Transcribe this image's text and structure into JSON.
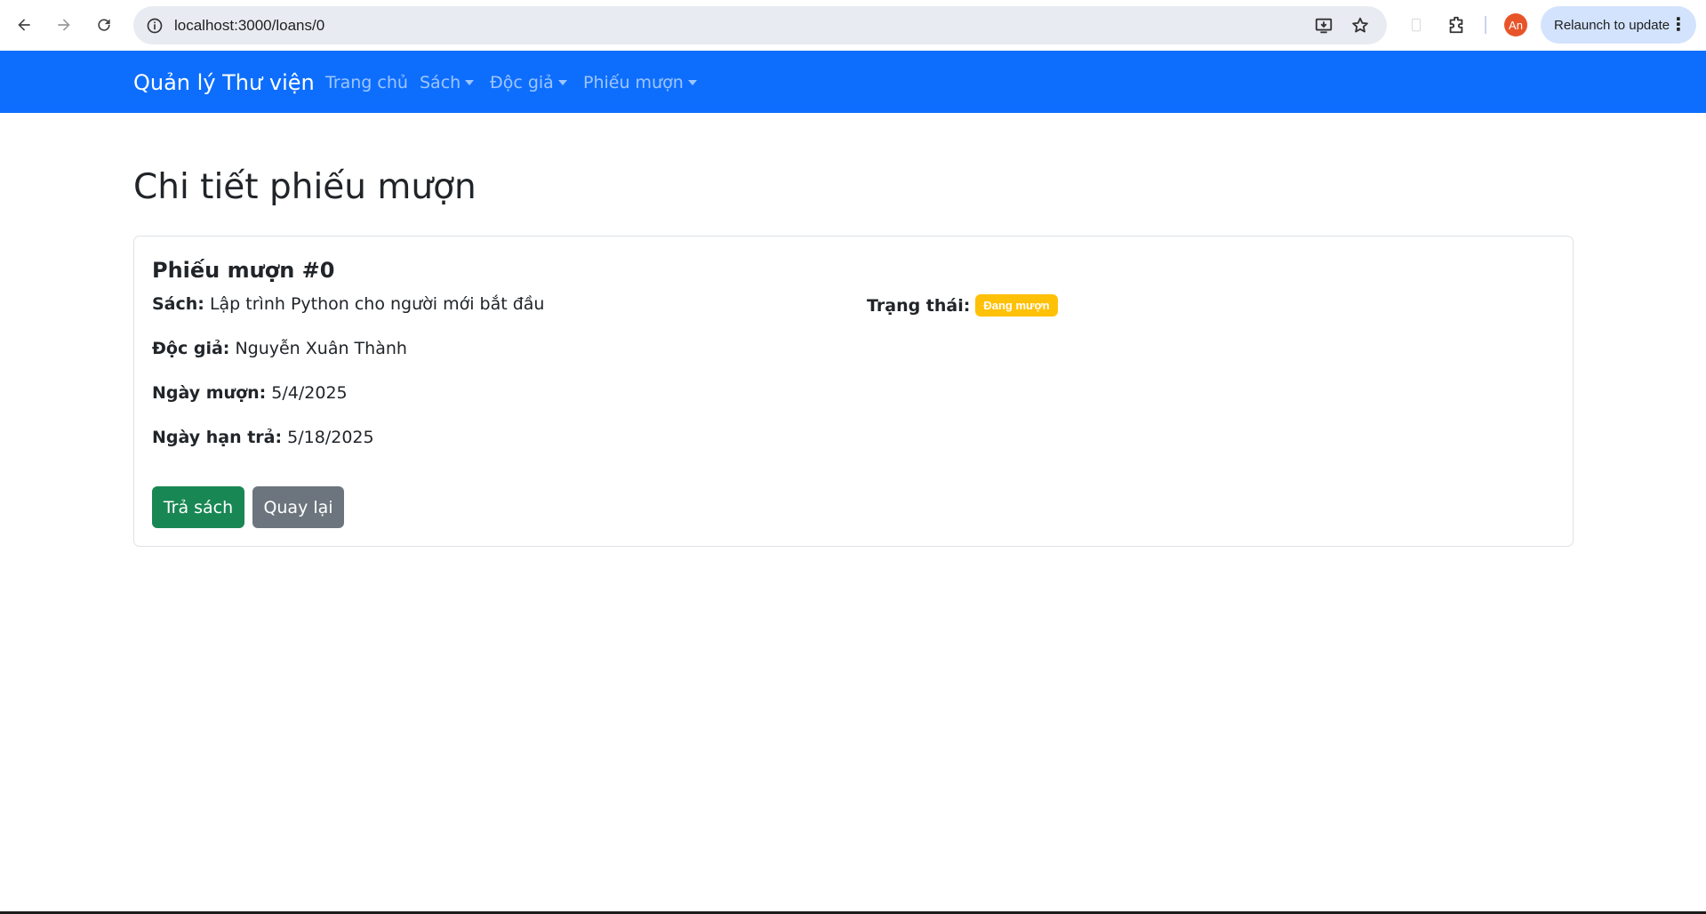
{
  "browser": {
    "url": "localhost:3000/loans/0",
    "profile_initial": "An",
    "relaunch_label": "Relaunch to update",
    "icons": [
      "back-arrow-icon",
      "forward-arrow-icon",
      "reload-icon",
      "site-info-icon",
      "install-app-icon",
      "bookmark-star-icon",
      "extensions-icon",
      "more-vert-icon"
    ]
  },
  "navbar": {
    "brand": "Quản lý Thư viện",
    "links": [
      {
        "label": "Trang chủ",
        "dropdown": false
      },
      {
        "label": "Sách",
        "dropdown": true
      },
      {
        "label": "Độc giả",
        "dropdown": true
      },
      {
        "label": "Phiếu mượn",
        "dropdown": true
      }
    ]
  },
  "page": {
    "title": "Chi tiết phiếu mượn"
  },
  "loan": {
    "title": "Phiếu mượn #0",
    "book_label": "Sách:",
    "book_value": "Lập trình Python cho người mới bắt đầu",
    "reader_label": "Độc giả:",
    "reader_value": "Nguyễn Xuân Thành",
    "borrow_date_label": "Ngày mượn:",
    "borrow_date_value": "5/4/2025",
    "due_date_label": "Ngày hạn trả:",
    "due_date_value": "5/18/2025",
    "status_label": "Trạng thái:",
    "status_value": "Đang mượn"
  },
  "actions": {
    "return_label": "Trả sách",
    "back_label": "Quay lại"
  },
  "colors": {
    "navbar": "#0d6efd",
    "badge_warning": "#ffc107",
    "button_success": "#198754",
    "button_secondary": "#6c757d"
  }
}
